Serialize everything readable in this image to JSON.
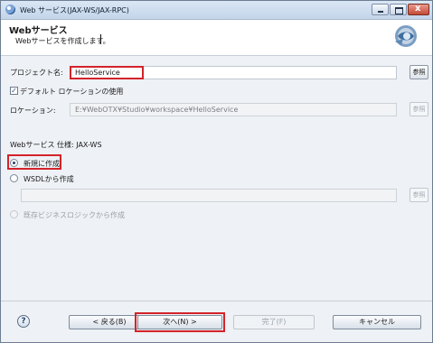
{
  "window": {
    "title": "Web サービス(JAX-WS/JAX-RPC)",
    "controls": {
      "minimize": "",
      "maximize": "",
      "close": "x"
    }
  },
  "header": {
    "title": "Webサービス",
    "description": "Webサービスを作成します。"
  },
  "form": {
    "project_label": "プロジェクト名:",
    "project_value": "HelloService",
    "browse_label": "参照",
    "default_location_label": "デフォルト ロケーションの使用",
    "default_location_checked": true,
    "location_label": "ロケーション:",
    "location_value": "E:¥WebOTX¥Studio¥workspace¥HelloService",
    "spec_label": "Webサービス 仕様: JAX-WS",
    "options": [
      {
        "label": "新規に作成",
        "selected": true,
        "enabled": true
      },
      {
        "label": "WSDLから作成",
        "selected": false,
        "enabled": true
      },
      {
        "label": "既存ビジネスロジックから作成",
        "selected": false,
        "enabled": false
      }
    ],
    "wsdl_value": ""
  },
  "footer": {
    "help": "?",
    "back": "< 戻る(B)",
    "next": "次へ(N) >",
    "finish": "完了(F)",
    "cancel": "キャンセル"
  },
  "colors": {
    "highlight": "#d3232a",
    "titlebar": "#c4d5ea",
    "accent": "#2a4f82"
  },
  "icons": [
    "window-app-icon",
    "webservice-banner-icon",
    "help-icon"
  ]
}
